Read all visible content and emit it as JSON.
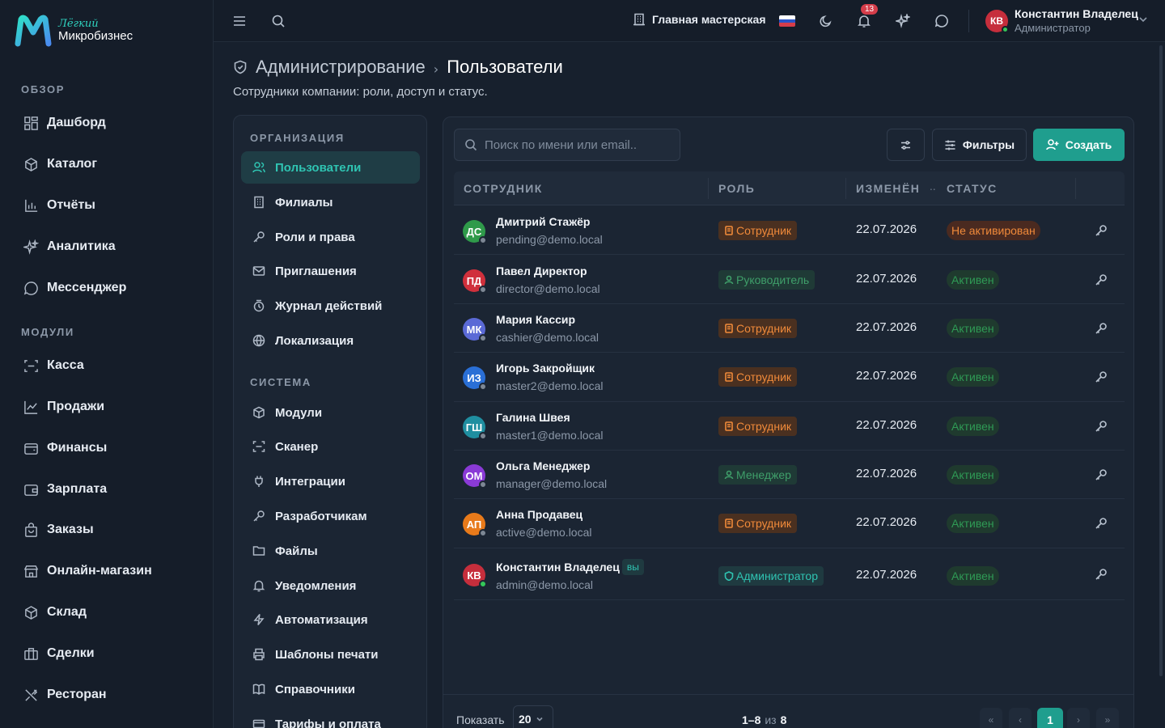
{
  "app": {
    "logo_top": "Лёгкий",
    "logo_bottom": "Микробизнес"
  },
  "sidebar": {
    "sections": [
      {
        "title": "ОБЗОР"
      },
      {
        "title": "МОДУЛИ"
      }
    ],
    "items": [
      {
        "label": "Дашборд",
        "icon": "dashboard-icon"
      },
      {
        "label": "Каталог",
        "icon": "catalog-icon"
      },
      {
        "label": "Отчёты",
        "icon": "reports-icon"
      },
      {
        "label": "Аналитика",
        "icon": "sparkle-icon"
      },
      {
        "label": "Мессенджер",
        "icon": "chat-icon"
      },
      {
        "label": "Касса",
        "icon": "scanner-icon"
      },
      {
        "label": "Продажи",
        "icon": "chart-line-icon"
      },
      {
        "label": "Финансы",
        "icon": "wallet-icon"
      },
      {
        "label": "Зарплата",
        "icon": "wallet-icon"
      },
      {
        "label": "Заказы",
        "icon": "bag-icon"
      },
      {
        "label": "Онлайн-магазин",
        "icon": "store-icon"
      },
      {
        "label": "Склад",
        "icon": "box-icon"
      },
      {
        "label": "Сделки",
        "icon": "briefcase-icon"
      },
      {
        "label": "Ресторан",
        "icon": "utensils-icon"
      }
    ]
  },
  "topbar": {
    "workshop": "Главная мастерская",
    "notifications_count": "13",
    "user_initials": "КВ",
    "user_name": "Константин Владелец",
    "user_role": "Администратор"
  },
  "header": {
    "crumb_parent": "Администрирование",
    "crumb_sep": "›",
    "crumb_current": "Пользователи",
    "subtitle": "Сотрудники компании: роли, доступ и статус."
  },
  "subnav": {
    "sections": [
      {
        "title": "ОРГАНИЗАЦИЯ"
      },
      {
        "title": "СИСТЕМА"
      }
    ],
    "items": [
      {
        "label": "Пользователи",
        "icon": "users-icon"
      },
      {
        "label": "Филиалы",
        "icon": "building-icon"
      },
      {
        "label": "Роли и права",
        "icon": "key-icon"
      },
      {
        "label": "Приглашения",
        "icon": "mail-icon"
      },
      {
        "label": "Журнал действий",
        "icon": "log-icon"
      },
      {
        "label": "Локализация",
        "icon": "globe-icon"
      },
      {
        "label": "Модули",
        "icon": "box-icon"
      },
      {
        "label": "Сканер",
        "icon": "scanner-icon"
      },
      {
        "label": "Интеграции",
        "icon": "plug-icon"
      },
      {
        "label": "Разработчикам",
        "icon": "key-icon"
      },
      {
        "label": "Файлы",
        "icon": "folder-icon"
      },
      {
        "label": "Уведомления",
        "icon": "bell-icon"
      },
      {
        "label": "Автоматизация",
        "icon": "bolt-icon"
      },
      {
        "label": "Шаблоны печати",
        "icon": "printer-icon"
      },
      {
        "label": "Справочники",
        "icon": "book-icon"
      },
      {
        "label": "Тарифы и оплата",
        "icon": "card-icon"
      }
    ]
  },
  "toolbar": {
    "search_placeholder": "Поиск по имени или email..",
    "filters_label": "Фильтры",
    "create_label": "Создать"
  },
  "table": {
    "columns": [
      "СОТРУДНИК",
      "РОЛЬ",
      "ИЗМЕНЁН",
      "СТАТУС"
    ],
    "rows": [
      {
        "initials": "ДС",
        "avatar_color": "#2f9a4a",
        "name": "Дмитрий Стажёр",
        "email": "pending@demo.local",
        "role": "Сотрудник",
        "role_style": "orange",
        "date": "22.07.2026",
        "status": "Не активирован",
        "status_style": "inactive",
        "online": false,
        "you": ""
      },
      {
        "initials": "ПД",
        "avatar_color": "#d0303c",
        "name": "Павел Директор",
        "email": "director@demo.local",
        "role": "Руководитель",
        "role_style": "green",
        "date": "22.07.2026",
        "status": "Активен",
        "status_style": "active",
        "online": false,
        "you": ""
      },
      {
        "initials": "МК",
        "avatar_color": "#5b6ad6",
        "name": "Мария Кассир",
        "email": "cashier@demo.local",
        "role": "Сотрудник",
        "role_style": "orange",
        "date": "22.07.2026",
        "status": "Активен",
        "status_style": "active",
        "online": false,
        "you": ""
      },
      {
        "initials": "ИЗ",
        "avatar_color": "#2a6fd6",
        "name": "Игорь Закройщик",
        "email": "master2@demo.local",
        "role": "Сотрудник",
        "role_style": "orange",
        "date": "22.07.2026",
        "status": "Активен",
        "status_style": "active",
        "online": false,
        "you": ""
      },
      {
        "initials": "ГШ",
        "avatar_color": "#1f8ea0",
        "name": "Галина Швея",
        "email": "master1@demo.local",
        "role": "Сотрудник",
        "role_style": "orange",
        "date": "22.07.2026",
        "status": "Активен",
        "status_style": "active",
        "online": false,
        "you": ""
      },
      {
        "initials": "ОМ",
        "avatar_color": "#8a3ad6",
        "name": "Ольга Менеджер",
        "email": "manager@demo.local",
        "role": "Менеджер",
        "role_style": "green",
        "date": "22.07.2026",
        "status": "Активен",
        "status_style": "active",
        "online": false,
        "you": ""
      },
      {
        "initials": "АП",
        "avatar_color": "#e87a1a",
        "name": "Анна Продавец",
        "email": "active@demo.local",
        "role": "Сотрудник",
        "role_style": "orange",
        "date": "22.07.2026",
        "status": "Активен",
        "status_style": "active",
        "online": false,
        "you": ""
      },
      {
        "initials": "КВ",
        "avatar_color": "#c62e3c",
        "name": "Константин Владелец",
        "email": "admin@demo.local",
        "role": "Администратор",
        "role_style": "teal",
        "date": "22.07.2026",
        "status": "Активен",
        "status_style": "active",
        "online": true,
        "you": "вы"
      }
    ]
  },
  "footer": {
    "show_label": "Показать",
    "page_size": "20",
    "range": "1–8",
    "range_of": "из",
    "total": "8",
    "current_page": "1"
  }
}
